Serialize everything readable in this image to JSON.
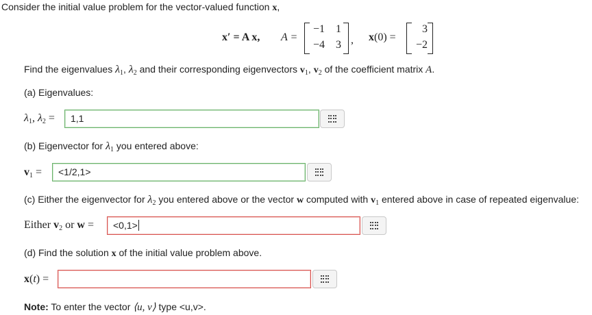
{
  "intro": {
    "text": "Consider the initial value problem for the vector-valued function",
    "var": "x",
    "comma": ","
  },
  "equation": {
    "lhs": "x′ = A x,",
    "a_label": "A =",
    "matrix": [
      [
        "−1",
        "1"
      ],
      [
        "−4",
        "3"
      ]
    ],
    "sep": ",",
    "x0_label": "x(0) =",
    "x0": [
      "3",
      "−2"
    ]
  },
  "find": {
    "pre": "Find the eigenvalues",
    "lam1": "λ",
    "s1": "1",
    "comma": ",",
    "lam2": "λ",
    "s2": "2",
    "mid": "and their corresponding eigenvectors",
    "v1": "v",
    "vs1": "1",
    "v2": "v",
    "vs2": "2",
    "post": "of the coefficient matrix",
    "A": "A",
    "dot": "."
  },
  "part_a": {
    "label": "(a) Eigenvalues:",
    "lhs_lam1": "λ",
    "lhs_s1": "1",
    "lhs_comma": ",",
    "lhs_lam2": "λ",
    "lhs_s2": "2",
    "eq": "=",
    "value": "1,1"
  },
  "part_b": {
    "pre": "(b) Eigenvector for",
    "lam": "λ",
    "s": "1",
    "post": "you entered above:",
    "lhs_v": "v",
    "lhs_s": "1",
    "eq": "=",
    "value": "<1/2,1>"
  },
  "part_c": {
    "pre": "(c) Either the eigenvector for",
    "lam": "λ",
    "s": "2",
    "mid": "you entered above or the vector",
    "w": "w",
    "mid2": "computed with",
    "v": "v",
    "vs": "1",
    "post": "entered above in case of repeated eigenvalue:",
    "lhs_either": "Either",
    "lhs_v": "v",
    "lhs_s": "2",
    "lhs_or": "or",
    "lhs_w": "w",
    "eq": "=",
    "value": "<0,1>"
  },
  "part_d": {
    "pre": "(d) Find the solution",
    "x": "x",
    "post": "of the initial value problem above.",
    "lhs": "x(t) =",
    "value": ""
  },
  "note": {
    "label": "Note:",
    "pre": "To enter the vector",
    "vec": "⟨u, v⟩",
    "post": "type <u,v>."
  },
  "colors": {
    "correct_border": "#6ab26a",
    "incorrect_border": "#d9534f"
  },
  "icons": {
    "palette": "equation-palette-grid-icon"
  }
}
